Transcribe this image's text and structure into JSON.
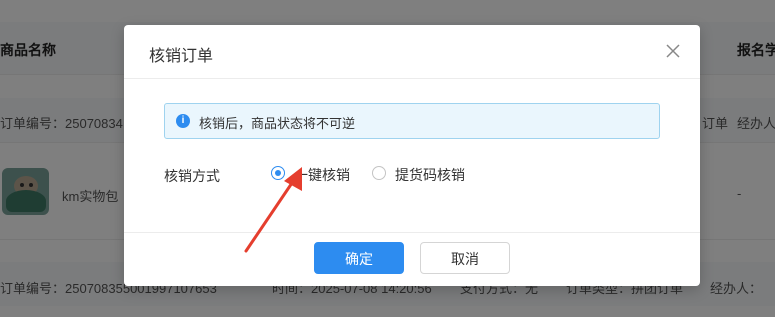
{
  "background": {
    "header": {
      "product_name": "商品名称",
      "report_col": "报名学"
    },
    "rows": [
      {
        "order_no": "订单编号：25070834",
        "type_suffix": "订单",
        "handler": "经办人"
      },
      {
        "product": "km实物包",
        "dash": "-"
      },
      {
        "order_no": "订单编号：250708355001997107653",
        "time": "时间：2025-07-08 14:20:56",
        "payment": "支付方式：无",
        "order_type": "订单类型：拼团订单",
        "handler": "经办人："
      }
    ]
  },
  "modal": {
    "title": "核销订单",
    "close_icon": "close-icon",
    "alert": {
      "icon": "info-icon",
      "text": "核销后，商品状态将不可逆"
    },
    "method_label": "核销方式",
    "options": [
      {
        "label": "一键核销",
        "checked": true
      },
      {
        "label": "提货码核销",
        "checked": false
      }
    ],
    "confirm_label": "确定",
    "cancel_label": "取消"
  },
  "colors": {
    "primary": "#2d8cf0",
    "annotation_arrow": "#e53e2e",
    "mask": "rgba(0,0,0,0.5)"
  }
}
